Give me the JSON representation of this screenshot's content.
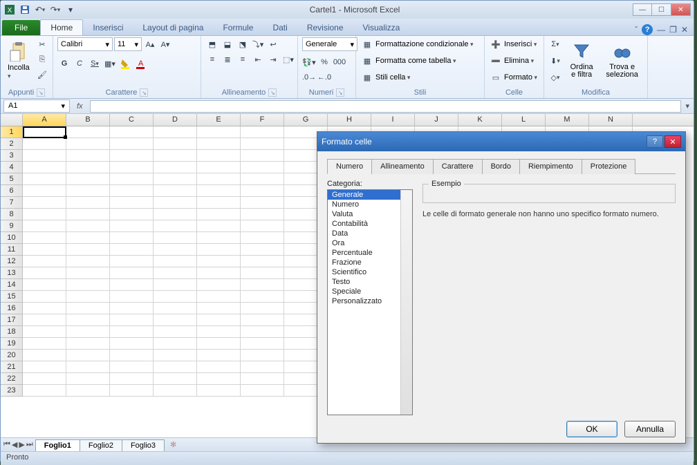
{
  "window": {
    "title": "Cartel1 - Microsoft Excel",
    "qat_icons": [
      "excel",
      "save",
      "undo",
      "redo"
    ]
  },
  "ribbon": {
    "file_label": "File",
    "tabs": [
      "Home",
      "Inserisci",
      "Layout di pagina",
      "Formule",
      "Dati",
      "Revisione",
      "Visualizza"
    ],
    "active_tab": 0,
    "groups": {
      "appunti": {
        "label": "Appunti",
        "paste": "Incolla"
      },
      "carattere": {
        "label": "Carattere",
        "font": "Calibri",
        "size": "11",
        "bold": "G",
        "italic": "C",
        "underline": "S"
      },
      "allineamento": {
        "label": "Allineamento"
      },
      "numeri": {
        "label": "Numeri",
        "format": "Generale"
      },
      "stili": {
        "label": "Stili",
        "cond": "Formattazione condizionale",
        "table": "Formatta come tabella",
        "cell": "Stili cella"
      },
      "celle": {
        "label": "Celle",
        "insert": "Inserisci",
        "delete": "Elimina",
        "format": "Formato"
      },
      "modifica": {
        "label": "Modifica",
        "sort": "Ordina e filtra",
        "find": "Trova e seleziona"
      }
    }
  },
  "namebox": {
    "cell": "A1"
  },
  "columns": [
    "A",
    "B",
    "C",
    "D",
    "E",
    "F",
    "G",
    "H",
    "I",
    "J",
    "K",
    "L",
    "M",
    "N"
  ],
  "rows_count": 23,
  "sheet_tabs": [
    "Foglio1",
    "Foglio2",
    "Foglio3"
  ],
  "active_sheet": 0,
  "status": "Pronto",
  "dialog": {
    "title": "Formato celle",
    "tabs": [
      "Numero",
      "Allineamento",
      "Carattere",
      "Bordo",
      "Riempimento",
      "Protezione"
    ],
    "active_tab": 0,
    "category_label": "Categoria:",
    "categories": [
      "Generale",
      "Numero",
      "Valuta",
      "Contabilità",
      "Data",
      "Ora",
      "Percentuale",
      "Frazione",
      "Scientifico",
      "Testo",
      "Speciale",
      "Personalizzato"
    ],
    "selected_category": 0,
    "sample_label": "Esempio",
    "description": "Le celle di formato generale non hanno uno specifico formato numero.",
    "ok": "OK",
    "cancel": "Annulla"
  }
}
